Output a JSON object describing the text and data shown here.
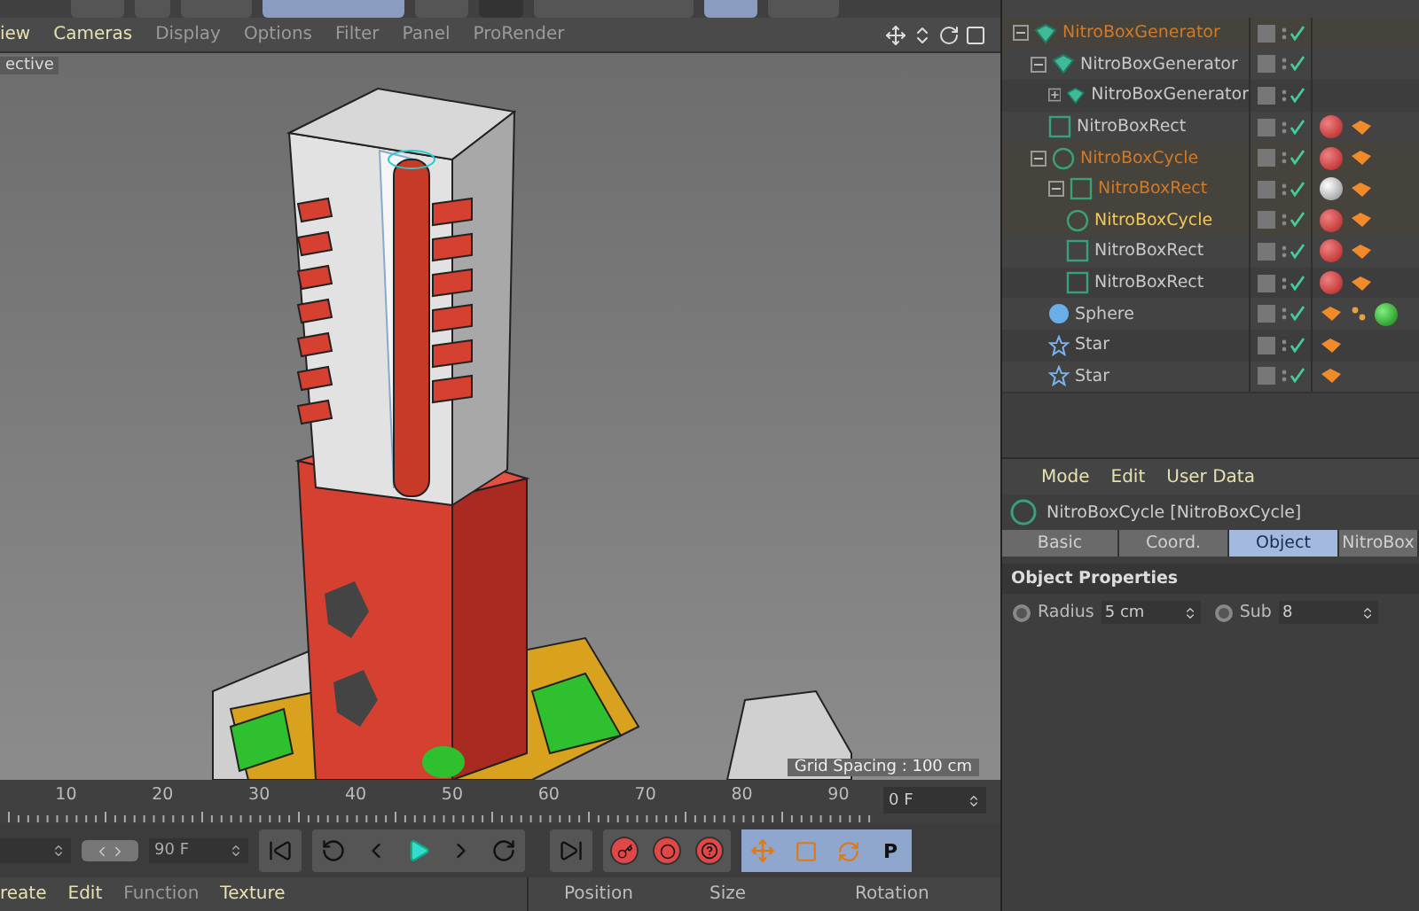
{
  "viewport": {
    "menu": [
      {
        "label": "iew",
        "dimmed": false
      },
      {
        "label": "Cameras",
        "dimmed": false
      },
      {
        "label": "Display",
        "dimmed": true
      },
      {
        "label": "Options",
        "dimmed": true
      },
      {
        "label": "Filter",
        "dimmed": true
      },
      {
        "label": "Panel",
        "dimmed": true
      },
      {
        "label": "ProRender",
        "dimmed": true
      }
    ],
    "camera_label": "ective",
    "grid_spacing": "Grid Spacing : 100 cm"
  },
  "objects": [
    {
      "name": "NitroBoxGenerator",
      "kind": "generator",
      "expanded": true,
      "selected": true,
      "active": false,
      "children": [
        {
          "name": "NitroBoxGenerator",
          "kind": "generator",
          "expanded": true,
          "selected": false,
          "active": false,
          "children": [
            {
              "name": "NitroBoxGenerator",
              "kind": "generator",
              "expanded": false,
              "selected": false,
              "active": false
            },
            {
              "name": "NitroBoxRect",
              "kind": "rect",
              "selected": false,
              "active": false,
              "tags": [
                {
                  "kind": "red"
                },
                {
                  "kind": "phong"
                }
              ]
            }
          ]
        },
        {
          "name": "NitroBoxCycle",
          "kind": "cycle",
          "expanded": true,
          "selected": true,
          "active": false,
          "tags": [
            {
              "kind": "red"
            },
            {
              "kind": "phong"
            }
          ],
          "children": [
            {
              "name": "NitroBoxRect",
              "kind": "rect",
              "expanded": true,
              "selected": true,
              "active": false,
              "tags": [
                {
                  "kind": "white"
                },
                {
                  "kind": "phong"
                }
              ],
              "children": [
                {
                  "name": "NitroBoxCycle",
                  "kind": "cycle",
                  "selected": true,
                  "active": true,
                  "tags": [
                    {
                      "kind": "red"
                    },
                    {
                      "kind": "phong"
                    }
                  ]
                },
                {
                  "name": "NitroBoxRect",
                  "kind": "rect",
                  "selected": false,
                  "active": false,
                  "tags": [
                    {
                      "kind": "red"
                    },
                    {
                      "kind": "phong"
                    }
                  ]
                },
                {
                  "name": "NitroBoxRect",
                  "kind": "rect",
                  "selected": false,
                  "active": false,
                  "tags": [
                    {
                      "kind": "red"
                    },
                    {
                      "kind": "phong"
                    }
                  ]
                }
              ]
            },
            {
              "name": "Sphere",
              "kind": "sphere",
              "selected": false,
              "active": false,
              "tags": [
                {
                  "kind": "phong"
                },
                {
                  "kind": "dots"
                },
                {
                  "kind": "green"
                }
              ]
            },
            {
              "name": "Star",
              "kind": "star",
              "selected": false,
              "active": false,
              "tags": [
                {
                  "kind": "phong"
                }
              ]
            },
            {
              "name": "Star",
              "kind": "star",
              "selected": false,
              "active": false,
              "tags": [
                {
                  "kind": "phong"
                }
              ]
            }
          ]
        }
      ]
    }
  ],
  "attributes": {
    "menu": [
      "Mode",
      "Edit",
      "User Data"
    ],
    "title": "NitroBoxCycle [NitroBoxCycle]",
    "tabs": [
      {
        "label": "Basic",
        "selected": false
      },
      {
        "label": "Coord.",
        "selected": false
      },
      {
        "label": "Object",
        "selected": true
      },
      {
        "label": "NitroBox",
        "selected": false
      }
    ],
    "section": "Object Properties",
    "fields": [
      {
        "label": "Radius",
        "value": "5 cm"
      },
      {
        "label": "Sub",
        "value": "8"
      }
    ]
  },
  "timeline": {
    "ticks": [
      "10",
      "20",
      "30",
      "40",
      "50",
      "60",
      "70",
      "80",
      "90"
    ],
    "current_frame": "0 F",
    "end_frame": "90 F",
    "pose_letter": "P"
  },
  "bottom_menu": [
    {
      "label": "reate",
      "dimmed": false
    },
    {
      "label": "Edit",
      "dimmed": false
    },
    {
      "label": "Function",
      "dimmed": true
    },
    {
      "label": "Texture",
      "dimmed": false
    }
  ],
  "coordinates": {
    "columns": [
      "Position",
      "Size",
      "Rotation"
    ]
  }
}
